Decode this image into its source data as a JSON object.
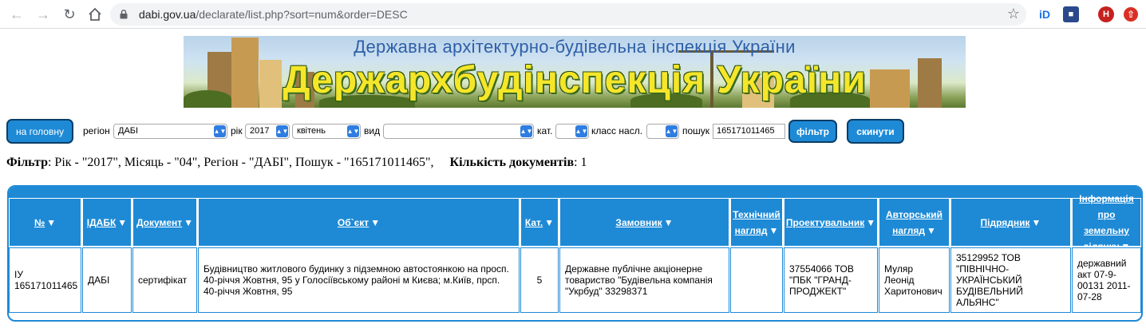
{
  "browser": {
    "url_host": "dabi.gov.ua",
    "url_path": "/declarate/list.php?sort=num&order=DESC",
    "avatar_letter": "H",
    "ext_id_label": "iD"
  },
  "banner": {
    "subtitle": "Державна архітектурно-будівельна інспекція України",
    "title": "Держархбудінспекція України"
  },
  "filters": {
    "home_button": "на головну",
    "region_label": "регіон",
    "region_value": "ДАБІ",
    "year_label": "рік",
    "year_value": "2017",
    "month_value": "квітень",
    "type_label": "вид",
    "type_value": "",
    "category_label": "кат.",
    "category_value": "",
    "class_label": "класс насл.",
    "class_value": "",
    "search_label": "пошук",
    "search_value": "165171011465",
    "filter_button": "фільтр",
    "reset_button": "скинути"
  },
  "summary": {
    "filter_label": "Фільтр",
    "filter_text": ": Рік - \"2017\", Місяць - \"04\", Регіон - \"ДАБІ\", Пошук - \"165171011465\",",
    "count_label": "Кількість документів",
    "count_text": ": 1"
  },
  "table": {
    "headers": [
      "№",
      "ІДАБК",
      "Документ",
      "Об`єкт",
      "Кат.",
      "Замовник",
      "Технічний нагляд",
      "Проектувальник",
      "Авторський нагляд",
      "Підрядник",
      "Інформація про земельну ділянку"
    ],
    "rows": [
      {
        "num": "ІУ 165171011465",
        "idabk": "ДАБІ",
        "document": "сертифікат",
        "object": "Будівництво житлового будинку з підземною автостоянкою на просп. 40-річчя Жовтня, 95 у Голосіївському районі м Києва; м.Київ, прсп. 40-річчя Жовтня, 95",
        "category": "5",
        "customer": "Державне публічне акціонерне товариство \"Будівельна компанія \"Укрбуд\" 33298371",
        "tech_supervision": "",
        "designer": "37554066 ТОВ \"ПБК \"ГРАНД-ПРОДЖЕКТ\"",
        "author_supervision": "Муляр Леонід Харитонович",
        "contractor": "35129952 ТОВ \"ПІВНІЧНО-УКРАЇНСЬКИЙ БУДІВЕЛЬНИЙ АЛЬЯНС\"",
        "land_info": "державний акт 07-9-00131 2011-07-28"
      }
    ]
  },
  "colors": {
    "accent": "#1e8ad6",
    "button_border": "#0a3d66",
    "banner_title": "#f5e62a",
    "banner_subtitle": "#2f5fa8"
  }
}
